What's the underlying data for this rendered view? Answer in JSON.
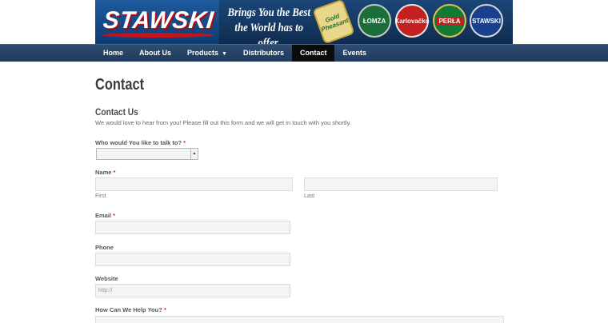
{
  "header": {
    "logo_text": "STAWSKI",
    "tagline_line1": "Brings You the Best",
    "tagline_line2": "the World has to offer.",
    "brand_badges": [
      "Gold Pheasant",
      "ŁOMŻA",
      "Karlovačko",
      "PERŁA",
      "STAWSKI"
    ]
  },
  "nav": {
    "items": [
      "Home",
      "About Us",
      "Products",
      "Distributors",
      "Contact",
      "Events"
    ],
    "active": "Contact"
  },
  "page": {
    "title": "Contact",
    "section_title": "Contact Us",
    "intro": "We would love to hear from you! Please fill out this form and we will get in touch with you shortly."
  },
  "form": {
    "talk_to_label": "Who would You like to talk to?",
    "talk_to_value": "",
    "required_mark": "*",
    "name_label": "Name",
    "first_label": "First",
    "last_label": "Last",
    "email_label": "Email",
    "phone_label": "Phone",
    "website_label": "Website",
    "website_placeholder": "http://",
    "help_label": "How Can We Help You?"
  },
  "colors": {
    "nav_bg": "#1e3a5c",
    "nav_active": "#0c0c0c",
    "required": "#c0392b",
    "field_bg": "#f4f4f4"
  }
}
